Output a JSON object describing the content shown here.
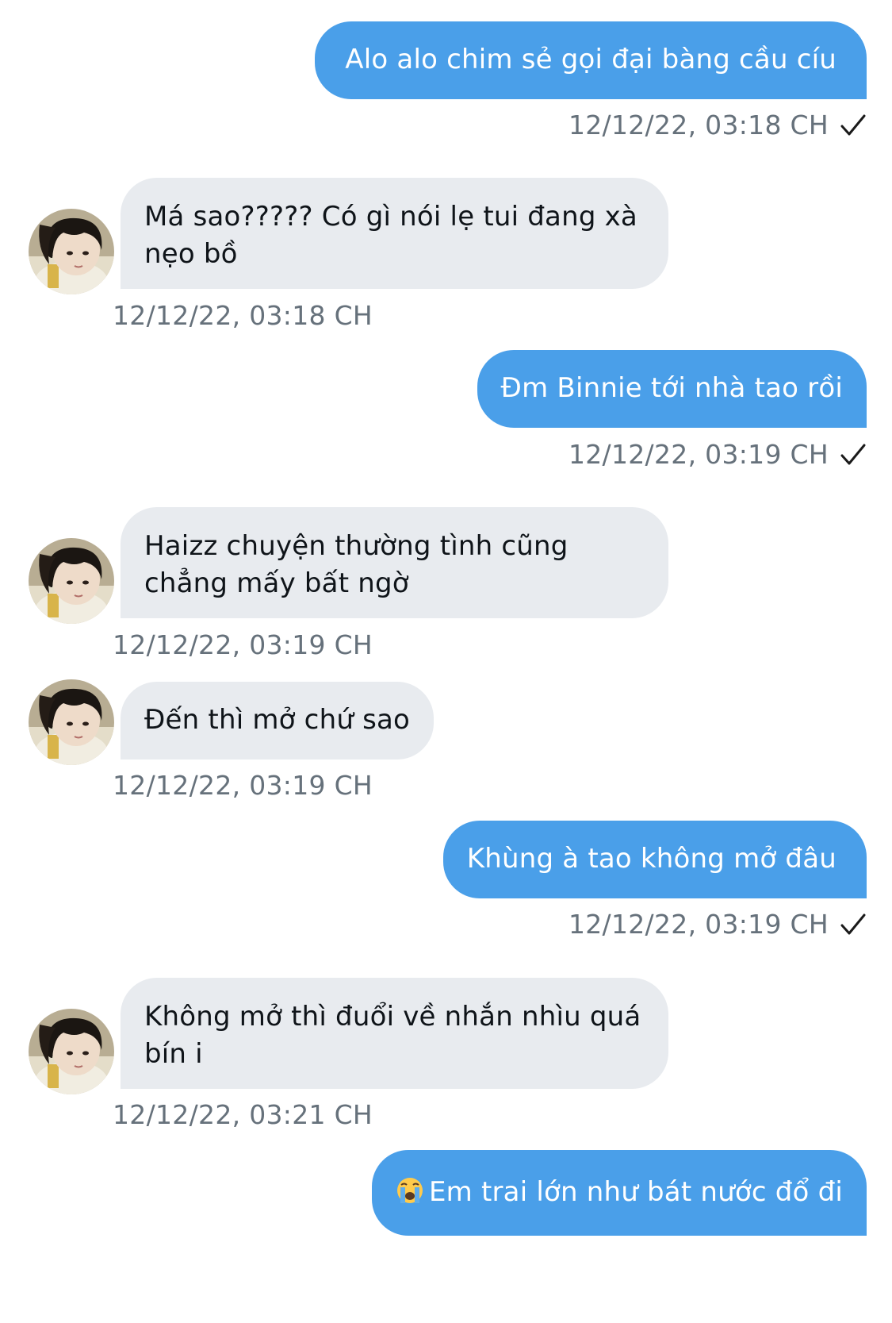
{
  "messages": [
    {
      "text": "Alo alo chim sẻ gọi đại bàng cầu cíu",
      "time": "12/12/22, 03:18 CH"
    },
    {
      "text": "Má sao????? Có gì nói lẹ tui đang xà nẹo bồ",
      "time": "12/12/22, 03:18 CH"
    },
    {
      "text": "Đm Binnie tới nhà tao rồi",
      "time": "12/12/22, 03:19 CH"
    },
    {
      "text": "Haizz chuyện thường tình cũng chẳng mấy bất ngờ",
      "time": "12/12/22, 03:19 CH"
    },
    {
      "text": "Đến thì mở chứ sao",
      "time": "12/12/22, 03:19 CH"
    },
    {
      "text": "Khùng à tao không mở đâu",
      "time": "12/12/22, 03:19 CH"
    },
    {
      "text": "Không mở thì đuổi về nhắn nhìu quá bín i",
      "time": "12/12/22, 03:21 CH"
    },
    {
      "text": "Em trai lớn như bát nước đổ đi",
      "emoji": "crying-face"
    }
  ],
  "colors": {
    "outgoing_bubble": "#4a9fe9",
    "incoming_bubble": "#e8ebef",
    "timestamp": "#66717b"
  },
  "icons": {
    "read_receipt": "check-icon",
    "avatar": "avatar"
  }
}
